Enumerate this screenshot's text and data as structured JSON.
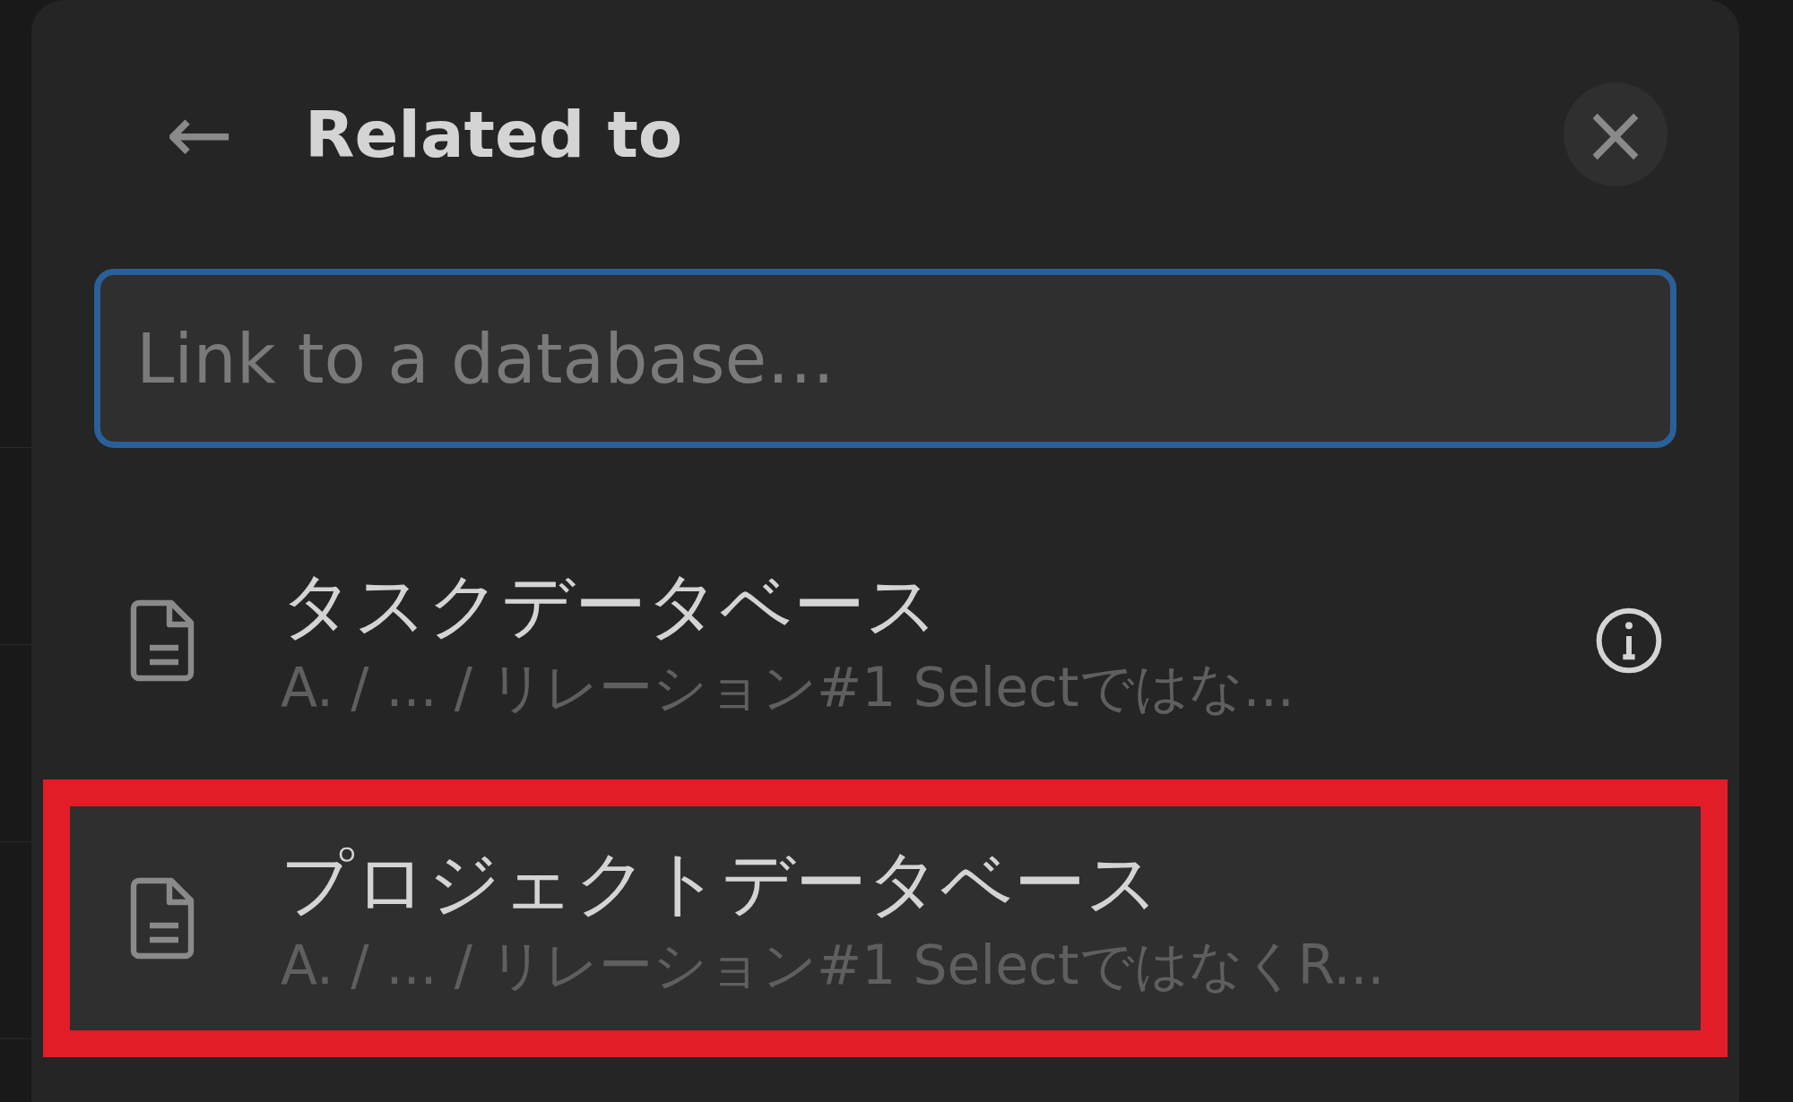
{
  "header": {
    "back": "←",
    "title": "Related to",
    "close": "×"
  },
  "search": {
    "placeholder": "Link to a database…"
  },
  "items": [
    {
      "title": "タスクデータベース",
      "path": "A. / ... / リレーション#1 Selectではな...",
      "info": true,
      "selected": false
    },
    {
      "title": "プロジェクトデータベース",
      "path": "A. / ... / リレーション#1 SelectではなくR...",
      "info": false,
      "selected": true
    }
  ]
}
